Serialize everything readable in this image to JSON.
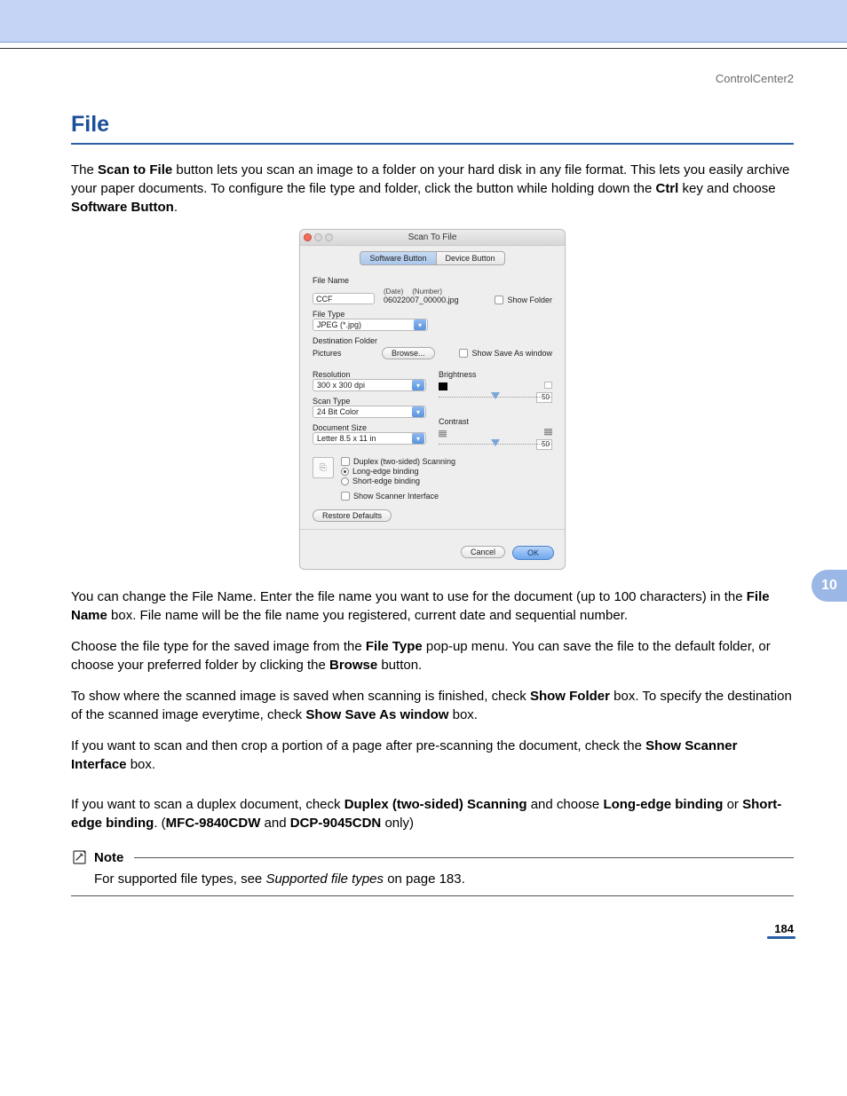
{
  "header": {
    "product": "ControlCenter2"
  },
  "section": {
    "title": "File"
  },
  "paras": {
    "p1a": "The ",
    "p1b": "Scan to File",
    "p1c": " button lets you scan an image to a folder on your hard disk in any file format. This lets you easily archive your paper documents. To configure the file type and folder, click the button while holding down the ",
    "p1d": "Ctrl",
    "p1e": " key and choose ",
    "p1f": "Software Button",
    "p1g": ".",
    "p2a": "You can change the File Name. Enter the file name you want to use for the document (up to 100 characters) in the ",
    "p2b": "File Name",
    "p2c": " box. File name will be the file name you registered, current date and sequential number.",
    "p3a": "Choose the file type for the saved image from the ",
    "p3b": "File Type",
    "p3c": " pop-up menu. You can save the file to the default folder, or choose your preferred folder by clicking the ",
    "p3d": "Browse",
    "p3e": " button.",
    "p4a": "To show where the scanned image is saved when scanning is finished, check ",
    "p4b": "Show Folder",
    "p4c": " box. To specify the destination of the scanned image everytime, check ",
    "p4d": "Show Save As window",
    "p4e": " box.",
    "p5a": "If you want to scan and then crop a portion of a page after pre-scanning the document, check the ",
    "p5b": "Show Scanner Interface",
    "p5c": " box.",
    "p6a": "If you want to scan a duplex document, check ",
    "p6b": "Duplex (two-sided) Scanning",
    "p6c": " and choose ",
    "p6d": "Long-edge binding",
    "p6e": " or ",
    "p6f": "Short-edge binding",
    "p6g": ". (",
    "p6h": "MFC-9840CDW",
    "p6i": " and ",
    "p6j": "DCP-9045CDN",
    "p6k": " only)"
  },
  "note": {
    "label": "Note",
    "body_a": "For supported file types, see ",
    "body_b": "Supported file types",
    "body_c": " on page 183."
  },
  "side_tab": "10",
  "page_number": "184",
  "dialog": {
    "title": "Scan To File",
    "tabs": {
      "software": "Software Button",
      "device": "Device Button"
    },
    "file_name_label": "File Name",
    "file_name_value": "CCF",
    "date_label": "(Date)",
    "number_label": "(Number)",
    "filename_preview": "06022007_00000.jpg",
    "show_folder": "Show Folder",
    "file_type_label": "File Type",
    "file_type_value": "JPEG (*.jpg)",
    "dest_label": "Destination Folder",
    "dest_value": "Pictures",
    "browse": "Browse...",
    "show_save_as": "Show Save As window",
    "resolution_label": "Resolution",
    "resolution_value": "300 x 300 dpi",
    "scan_type_label": "Scan Type",
    "scan_type_value": "24 Bit Color",
    "doc_size_label": "Document Size",
    "doc_size_value": "Letter  8.5 x 11 in",
    "brightness_label": "Brightness",
    "brightness_value": "50",
    "contrast_label": "Contrast",
    "contrast_value": "50",
    "duplex": "Duplex (two-sided) Scanning",
    "long_edge": "Long-edge binding",
    "short_edge": "Short-edge binding",
    "show_scanner": "Show Scanner Interface",
    "restore": "Restore Defaults",
    "cancel": "Cancel",
    "ok": "OK"
  }
}
